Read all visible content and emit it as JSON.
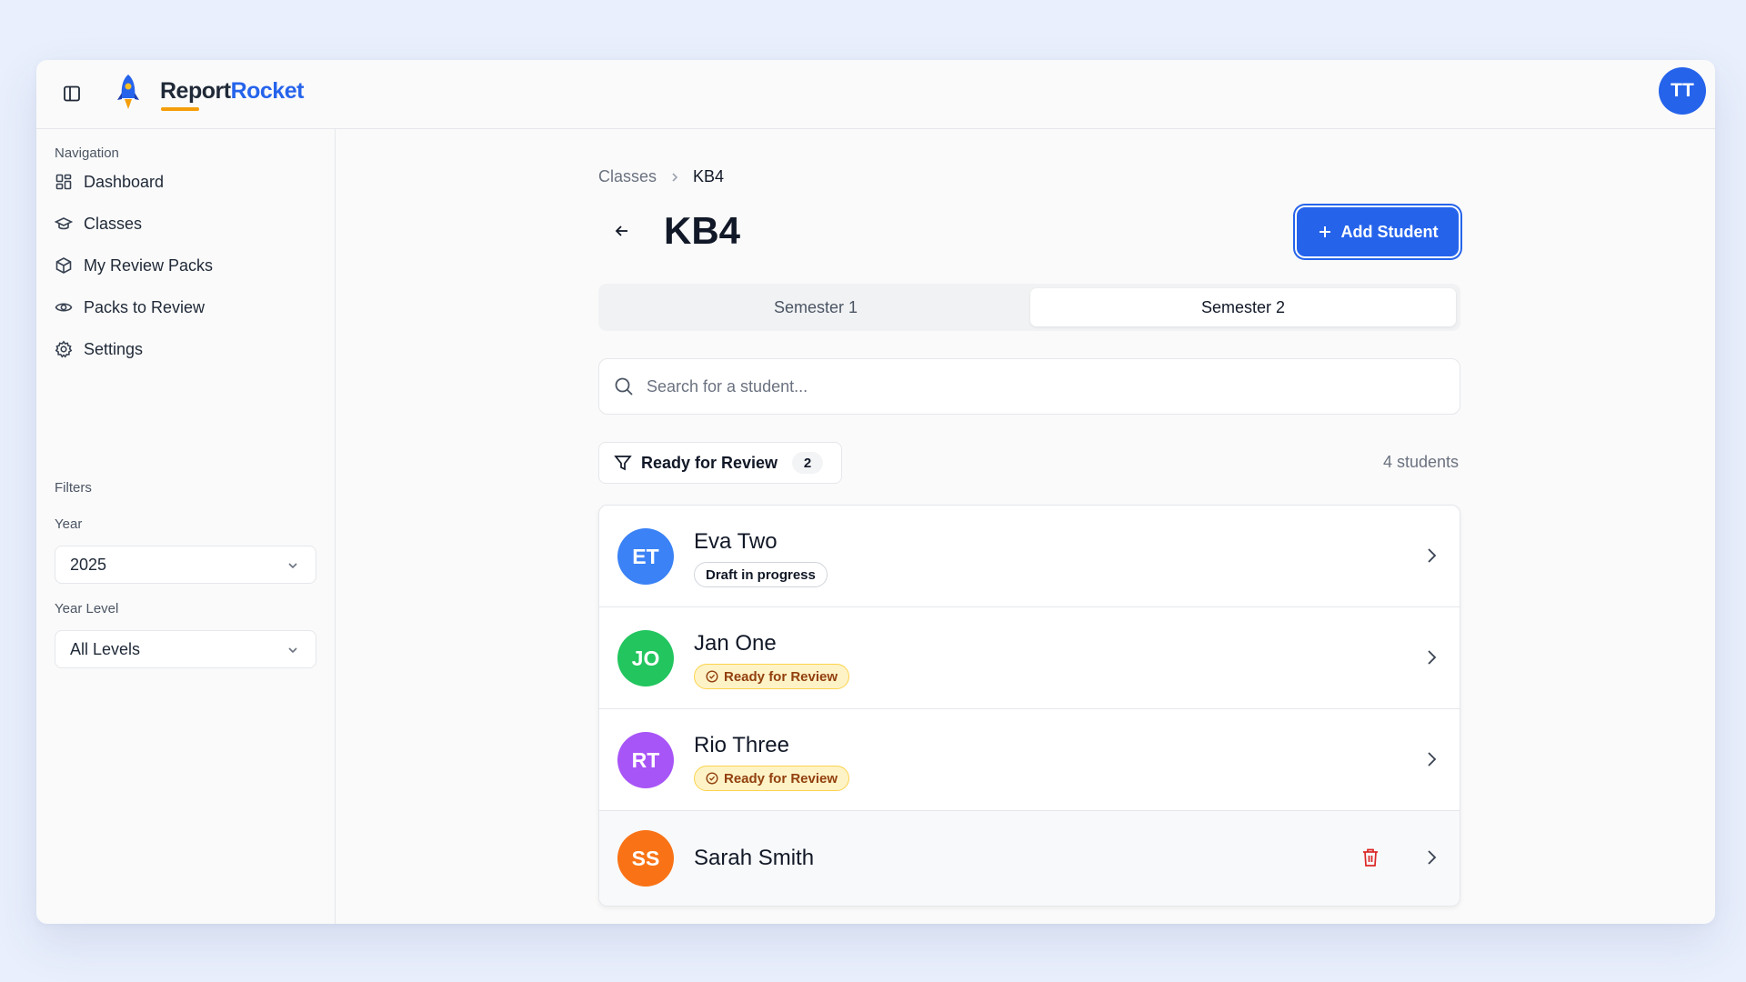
{
  "app": {
    "brand_part1": "Report",
    "brand_part2": "Rocket",
    "user_initials": "TT"
  },
  "sidebar": {
    "nav_heading": "Navigation",
    "items": [
      {
        "label": "Dashboard",
        "icon": "dashboard-icon"
      },
      {
        "label": "Classes",
        "icon": "graduation-cap-icon"
      },
      {
        "label": "My Review Packs",
        "icon": "package-icon"
      },
      {
        "label": "Packs to Review",
        "icon": "eye-icon"
      },
      {
        "label": "Settings",
        "icon": "gear-icon"
      }
    ],
    "filters_heading": "Filters",
    "year_label": "Year",
    "year_value": "2025",
    "year_level_label": "Year Level",
    "year_level_value": "All Levels"
  },
  "breadcrumb": {
    "parent": "Classes",
    "current": "KB4"
  },
  "page": {
    "title": "KB4",
    "add_button": "Add Student",
    "tabs": [
      {
        "label": "Semester 1"
      },
      {
        "label": "Semester 2",
        "active": true
      }
    ],
    "search_placeholder": "Search for a student...",
    "filter_label": "Ready for Review",
    "filter_count": "2",
    "student_count": "4 students"
  },
  "students": [
    {
      "initials": "ET",
      "name": "Eva Two",
      "status": "Draft in progress",
      "status_type": "draft",
      "color": "#3b82f6"
    },
    {
      "initials": "JO",
      "name": "Jan One",
      "status": "Ready for Review",
      "status_type": "ready",
      "color": "#22c55e"
    },
    {
      "initials": "RT",
      "name": "Rio Three",
      "status": "Ready for Review",
      "status_type": "ready",
      "color": "#a855f7"
    },
    {
      "initials": "SS",
      "name": "Sarah Smith",
      "status": "",
      "status_type": "none",
      "color": "#f97316"
    }
  ]
}
